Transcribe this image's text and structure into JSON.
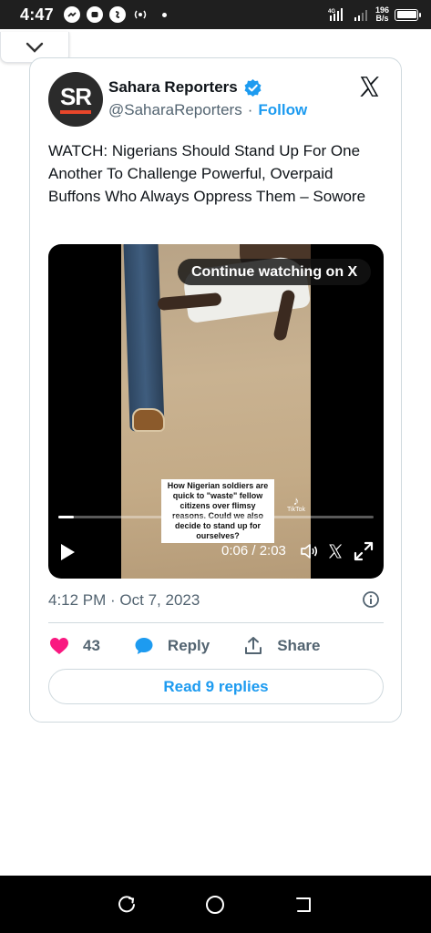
{
  "status_bar": {
    "time": "4:47",
    "network_speed_value": "196",
    "network_speed_unit": "B/s",
    "network_type": "4G"
  },
  "tweet": {
    "display_name": "Sahara Reporters",
    "handle": "@SaharaReporters",
    "separator": "·",
    "follow_label": "Follow",
    "avatar_text": "SR",
    "text": "WATCH: Nigerians Should Stand Up For One Another To Challenge Powerful, Overpaid Buffons Who Always Oppress Them – Sowore",
    "timestamp": "4:12 PM · Oct 7, 2023",
    "likes_count": "43",
    "reply_label": "Reply",
    "share_label": "Share",
    "read_replies_label": "Read 9 replies"
  },
  "video": {
    "continue_label": "Continue watching on X",
    "caption": "How Nigerian soldiers are quick to \"waste\" fellow citizens over flimsy reasons. Could we also decide to stand up for ourselves?",
    "tiktok_label": "TikTok",
    "current_time": "0:06",
    "duration": "2:03",
    "time_display": "0:06 / 2:03",
    "progress_fraction": 0.049
  },
  "colors": {
    "accent": "#1d9bf0",
    "like": "#f91880",
    "text_primary": "#0f1419",
    "text_secondary": "#536471",
    "border": "#cfd9de"
  },
  "icons": [
    "collapse-chevron-icon",
    "verified-badge-icon",
    "x-logo-icon",
    "play-icon",
    "volume-icon",
    "fullscreen-icon",
    "info-icon",
    "heart-icon",
    "reply-bubble-icon",
    "share-icon",
    "recent-apps-icon",
    "home-icon",
    "back-icon"
  ]
}
